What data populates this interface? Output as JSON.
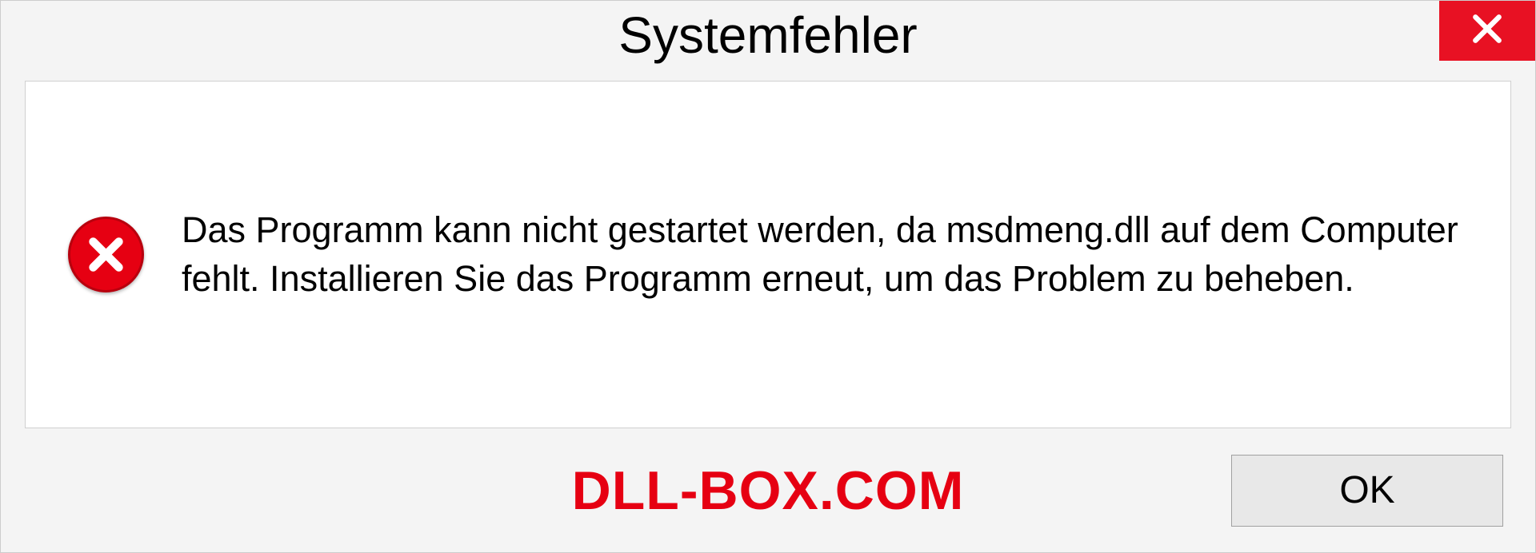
{
  "dialog": {
    "title": "Systemfehler",
    "message": "Das Programm kann nicht gestartet werden, da msdmeng.dll auf dem Computer fehlt. Installieren Sie das Programm erneut, um das Problem zu beheben.",
    "ok_label": "OK"
  },
  "watermark": {
    "text": "DLL-BOX.COM"
  }
}
